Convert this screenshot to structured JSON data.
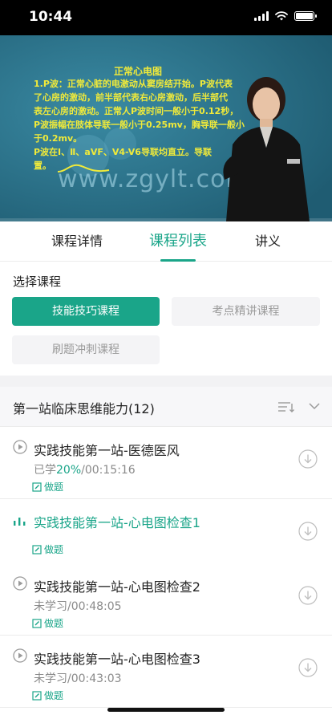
{
  "status": {
    "time": "10:44"
  },
  "video": {
    "slide_title": "正常心电图",
    "slide_lines": [
      "1.P波：正常心脏的电激动从窦房结开始。P波代表",
      "了心房的激动，前半部代表右心房激动，后半部代",
      "表左心房的激动。正常人P波时间一般小于0.12秒，",
      "P波振幅在肢体导联一般小于0.25mv，胸导联一般小",
      "于0.2mv。",
      "P波在Ⅰ、Ⅱ、aVF、V4-V6导联均直立。导联",
      "置。"
    ],
    "watermark": "www.zgylt.com"
  },
  "tabs": [
    {
      "label": "课程详情"
    },
    {
      "label": "课程列表"
    },
    {
      "label": "讲义"
    }
  ],
  "select": {
    "title": "选择课程",
    "options": [
      {
        "label": "技能技巧课程"
      },
      {
        "label": "考点精讲课程"
      },
      {
        "label": "刷题冲刺课程"
      }
    ]
  },
  "chapter": {
    "title": "第一站临床思维能力(12)"
  },
  "lessons": [
    {
      "title": "实践技能第一站-医德医风",
      "meta_prefix": "已学",
      "progress": "20%",
      "duration": "/00:15:16",
      "quiz": "做题"
    },
    {
      "title": "实践技能第一站-心电图检查1",
      "quiz": "做题"
    },
    {
      "title": "实践技能第一站-心电图检查2",
      "meta": "未学习/00:48:05",
      "quiz": "做题"
    },
    {
      "title": "实践技能第一站-心电图检查3",
      "meta": "未学习/00:43:03",
      "quiz": "做题"
    }
  ],
  "colors": {
    "accent": "#1aa589",
    "video_bg": "#2a6f86",
    "slide_text": "#f0ea3a"
  }
}
